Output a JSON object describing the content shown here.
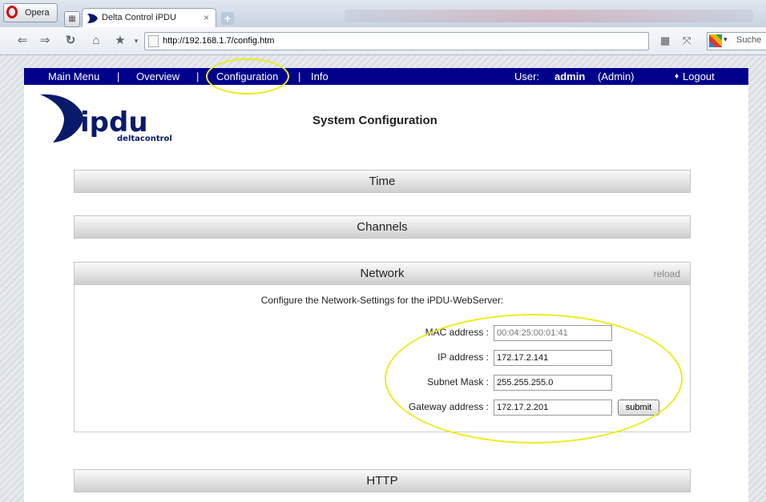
{
  "browser": {
    "menu_label": "Opera",
    "tab_title": "Delta Control iPDU",
    "url": "http://192.168.1.7/config.htm",
    "search_placeholder": "Suche"
  },
  "nav": {
    "main_menu": "Main Menu",
    "overview": "Overview",
    "configuration": "Configuration",
    "info": "Info",
    "sep": "|",
    "user_label": "User:",
    "user_name": "admin",
    "user_role": "(Admin)",
    "logout": "Logout"
  },
  "logo": {
    "main": "ipdu",
    "sub": "deltacontrol"
  },
  "page_title": "System Configuration",
  "sections": {
    "time": "Time",
    "channels": "Channels",
    "network": "Network",
    "http": "HTTP"
  },
  "network": {
    "reload": "reload",
    "intro": "Configure the Network-Settings for the iPDU-WebServer:",
    "mac_label": "MAC address :",
    "mac_value": "00:04:25:00:01:41",
    "ip_label": "IP address :",
    "ip_value": "172.17.2.141",
    "subnet_label": "Subnet Mask :",
    "subnet_value": "255.255.255.0",
    "gateway_label": "Gateway address :",
    "gateway_value": "172.17.2.201",
    "submit": "submit"
  },
  "colors": {
    "nav_bg": "#00008b",
    "highlight": "#ecec1e"
  }
}
